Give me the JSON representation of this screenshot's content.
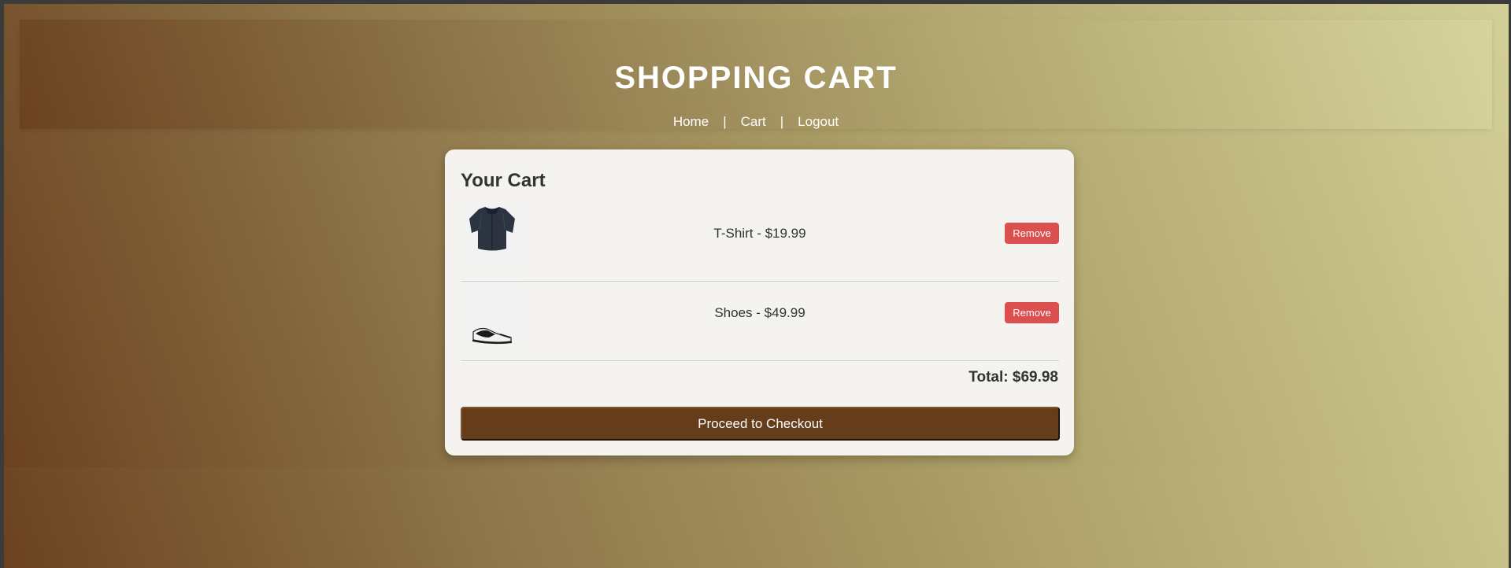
{
  "header": {
    "title": "SHOPPING CART",
    "nav": {
      "home": "Home",
      "separator": "|",
      "cart": "Cart",
      "logout": "Logout"
    }
  },
  "cart": {
    "title": "Your Cart",
    "items": [
      {
        "name": "T-Shirt - $19.99",
        "remove_label": "Remove",
        "icon": "shirt-icon"
      },
      {
        "name": "Shoes - $49.99",
        "remove_label": "Remove",
        "icon": "sneaker-icon"
      }
    ],
    "total": "Total: $69.98",
    "checkout_label": "Proceed to Checkout"
  },
  "colors": {
    "remove_button": "#dc4f4f",
    "checkout_button": "#653d1a",
    "card_background": "#f5f3ef",
    "gradient_start": "#6b4220",
    "gradient_end": "#d3cf98"
  }
}
